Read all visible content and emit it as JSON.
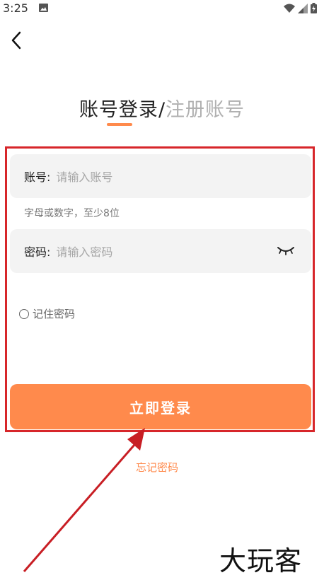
{
  "status_bar": {
    "time": "3:25"
  },
  "header": {
    "back_icon": "back-arrow-icon"
  },
  "tabs": {
    "login_label": "账号登录",
    "separator": "/",
    "register_label": "注册账号"
  },
  "form": {
    "account": {
      "label": "账号:",
      "placeholder": "请输入账号"
    },
    "account_hint": "字母或数字，至少8位",
    "password": {
      "label": "密码:",
      "placeholder": "请输入密码",
      "toggle_icon": "eye-closed-icon"
    },
    "remember_label": "记住密码",
    "login_button_label": "立即登录",
    "forgot_password_label": "忘记密码"
  },
  "watermark": {
    "text": "大玩客"
  },
  "colors": {
    "accent": "#ff8a4c",
    "annotation_red": "#d7262a",
    "field_bg": "#f3f3f3",
    "placeholder": "#a6a6a6"
  }
}
